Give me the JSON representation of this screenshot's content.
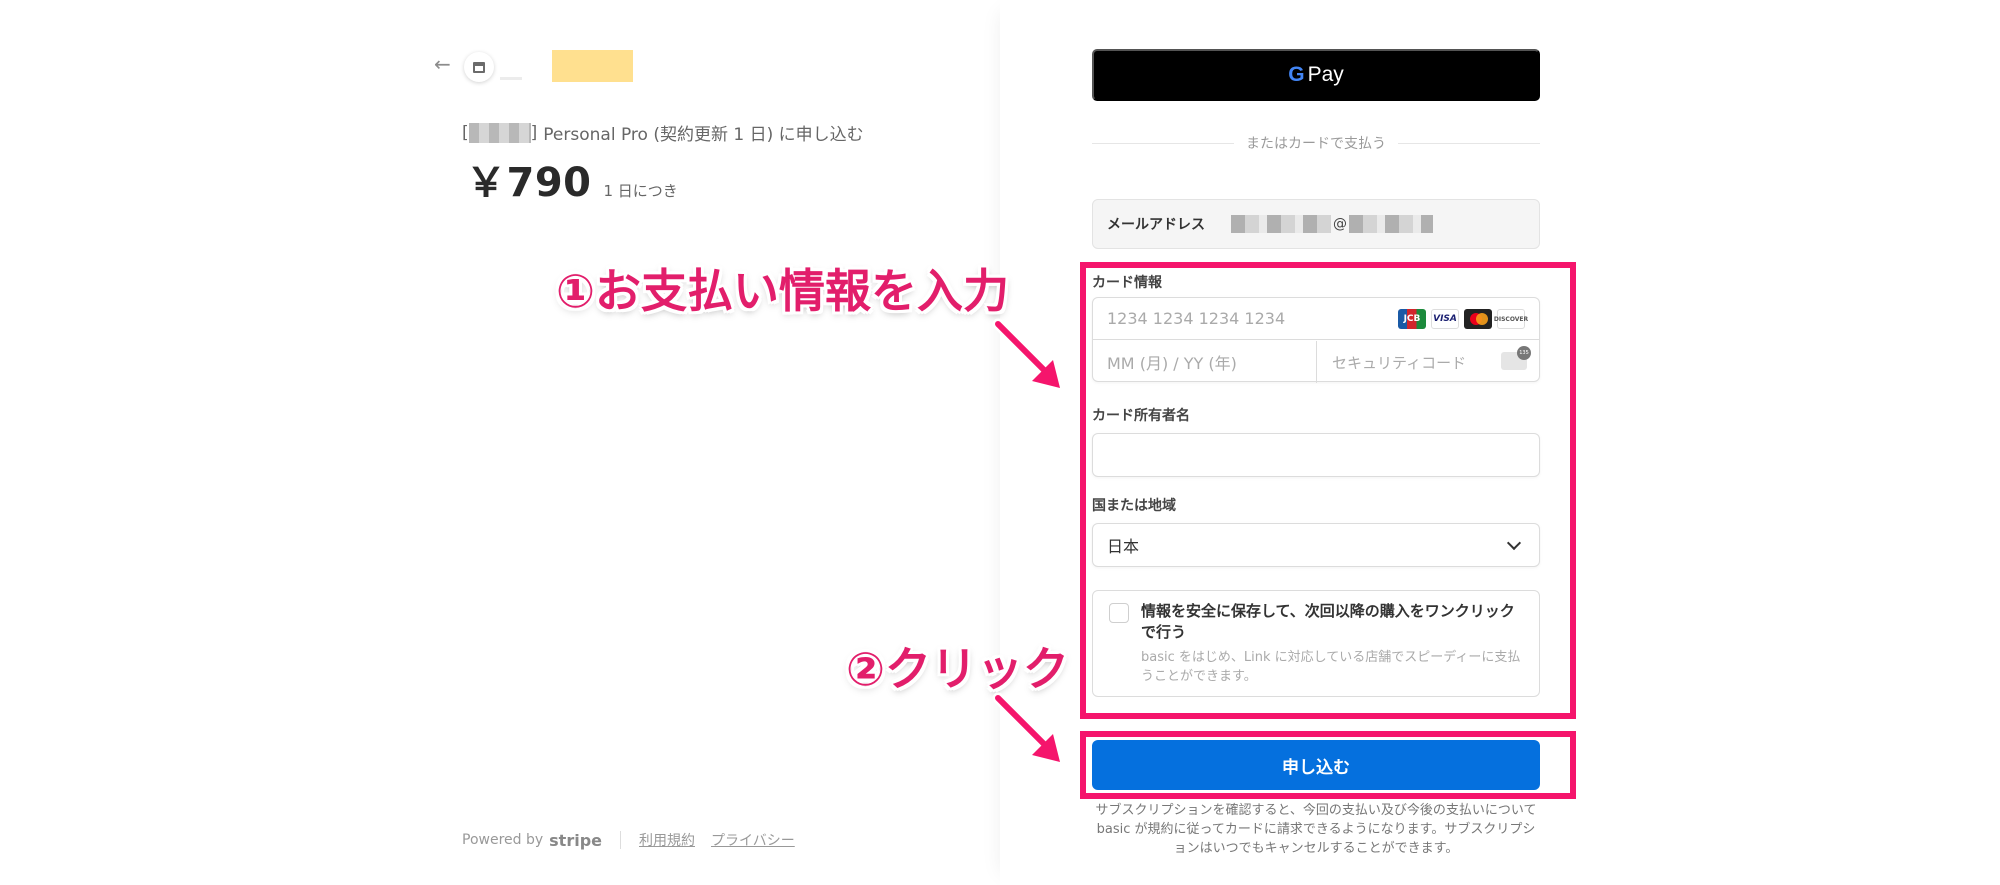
{
  "left": {
    "back_icon": "arrow-left-icon",
    "product": {
      "bracket_open": "[",
      "bracket_close": "]",
      "title": "Personal Pro (契約更新 1 日) に申し込む"
    },
    "price": "￥790",
    "period": "1 日につき",
    "footer": {
      "powered_by": "Powered by",
      "brand": "stripe",
      "terms": "利用規約",
      "privacy": "プライバシー"
    }
  },
  "payment": {
    "gpay_g": "G",
    "gpay_label": "Pay",
    "divider": "またはカードで支払う",
    "email_label": "メールアドレス",
    "email_at": "@",
    "card_label": "カード情報",
    "card_number_placeholder": "1234 1234 1234 1234",
    "card_brands": [
      "JCB",
      "VISA",
      "",
      "DISCOVER"
    ],
    "expiry_placeholder": "MM (月) / YY (年)",
    "cvc_placeholder": "セキュリティコード",
    "name_label": "カード所有者名",
    "country_label": "国または地域",
    "country_value": "日本",
    "save_title": "情報を安全に保存して、次回以降の購入をワンクリックで行う",
    "save_desc": "basic をはじめ、Link に対応している店舗でスピーディーに支払うことができます。",
    "submit": "申し込む",
    "terms": "サブスクリプションを確認すると、今回の支払い及び今後の支払いについて basic が規約に従ってカードに請求できるようになります。サブスクリプションはいつでもキャンセルすることができます。"
  },
  "annotations": {
    "step1": "①お支払い情報を入力",
    "step2": "②クリック",
    "color": "#f5156c"
  }
}
